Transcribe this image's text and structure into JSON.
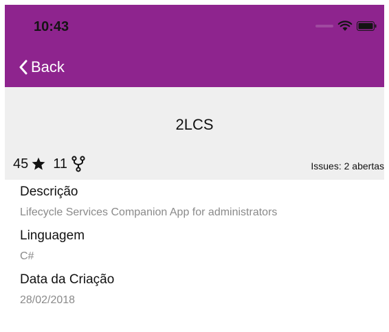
{
  "status_bar": {
    "time": "10:43"
  },
  "nav": {
    "back_label": "Back"
  },
  "repo": {
    "name": "2LCS",
    "stars": "45",
    "forks": "11",
    "issues": "Issues: 2 abertas"
  },
  "fields": [
    {
      "label": "Descrição",
      "value": "Lifecycle Services Companion App for administrators"
    },
    {
      "label": "Linguagem",
      "value": "C#"
    },
    {
      "label": "Data da Criação",
      "value": "28/02/2018"
    }
  ],
  "colors": {
    "accent": "#8e248e",
    "header_bg": "#efefef",
    "muted_text": "#8a8a8a"
  },
  "icons": [
    "wifi-icon",
    "battery-icon",
    "chevron-left-icon",
    "star-icon",
    "fork-icon"
  ]
}
